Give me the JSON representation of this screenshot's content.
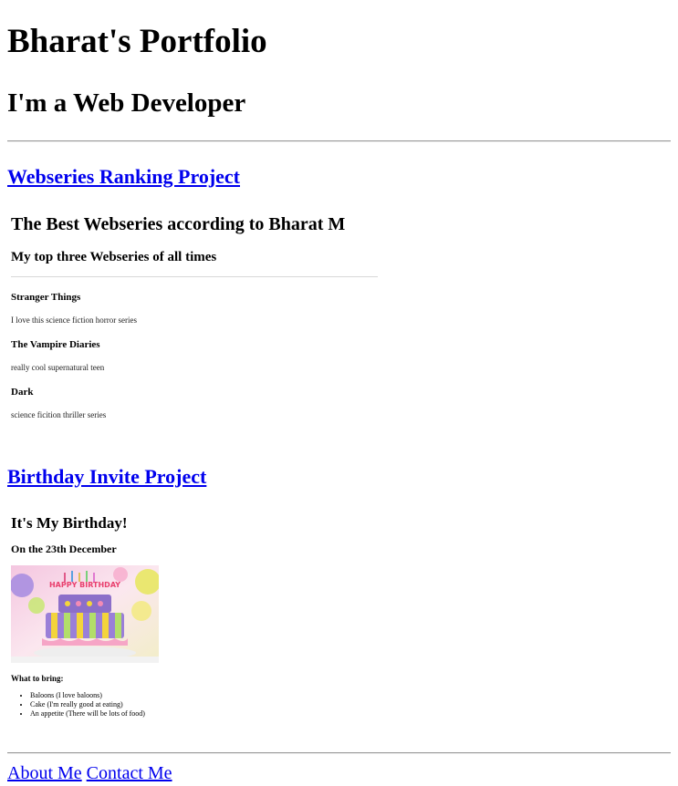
{
  "header": {
    "title": "Bharat's Portfolio",
    "subtitle": "I'm a Web Developer"
  },
  "projects": [
    {
      "link_label": "Webseries Ranking Project",
      "preview": {
        "title": "The Best Webseries according to Bharat M",
        "subtitle": "My top three Webseries of all times",
        "items": [
          {
            "name": "Stranger Things",
            "description": "I love this science fiction horror series"
          },
          {
            "name": "The Vampire Diaries",
            "description": "really cool supernatural teen"
          },
          {
            "name": "Dark",
            "description": "science ficition thriller series"
          }
        ]
      }
    },
    {
      "link_label": "Birthday Invite Project",
      "preview": {
        "title": "It's My Birthday!",
        "date": "On the 23th December",
        "image_text": "HAPPY BIRTHDAY",
        "bring_heading": "What to bring:",
        "bring_items": [
          "Baloons (I love baloons)",
          "Cake (I'm really good at eating)",
          "An appetite (There will be lots of food)"
        ]
      }
    }
  ],
  "footer": {
    "links": [
      "About Me",
      "Contact Me"
    ]
  },
  "colors": {
    "link": "#0000ee",
    "rule": "#9a9a9a"
  }
}
